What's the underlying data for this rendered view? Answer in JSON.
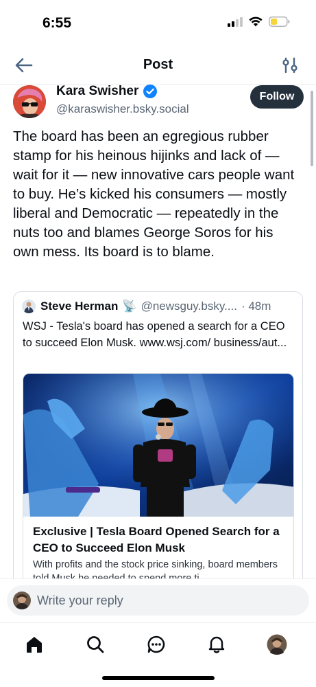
{
  "status_bar": {
    "time": "6:55",
    "icons": [
      "cellular-signal-icon",
      "wifi-icon",
      "battery-low-icon"
    ],
    "battery_color": "#f6d43a"
  },
  "header": {
    "title": "Post",
    "back_icon": "arrow-left-icon",
    "settings_icon": "sliders-icon"
  },
  "post": {
    "author_name": "Kara Swisher",
    "verified": true,
    "author_handle": "@karaswisher.bsky.social",
    "follow_label": "Follow",
    "text": "The board has been an egregious rubber stamp for his heinous hijinks and lack of — wait for it — new innovative cars people want to buy. He’s kicked his consumers — mostly liberal and Democratic — repeatedly in the nuts too and blames George Soros for his own mess. Its board is to blame."
  },
  "quote": {
    "author_name": "Steve Herman",
    "emoji": "📡",
    "handle": "@newsguy.bsky....",
    "time": "· 48m",
    "text": "WSJ - Tesla's board has opened a search for a CEO to succeed Elon Musk.  www.wsj.com/ business/aut...",
    "link_title": "Exclusive | Tesla Board Opened Search for a CEO to Succeed Elon Musk",
    "link_description": "With profits and the stock price sinking, board members told Musk he needed to spend more ti"
  },
  "reply": {
    "placeholder": "Write your reply"
  },
  "tabs": [
    {
      "name": "home",
      "icon": "home-icon"
    },
    {
      "name": "search",
      "icon": "search-icon"
    },
    {
      "name": "chat",
      "icon": "chat-icon"
    },
    {
      "name": "notifications",
      "icon": "bell-icon"
    },
    {
      "name": "profile",
      "icon": "avatar-icon"
    }
  ],
  "colors": {
    "accent": "#4b6584",
    "verified": "#1083fe",
    "follow_bg": "#25303d"
  }
}
